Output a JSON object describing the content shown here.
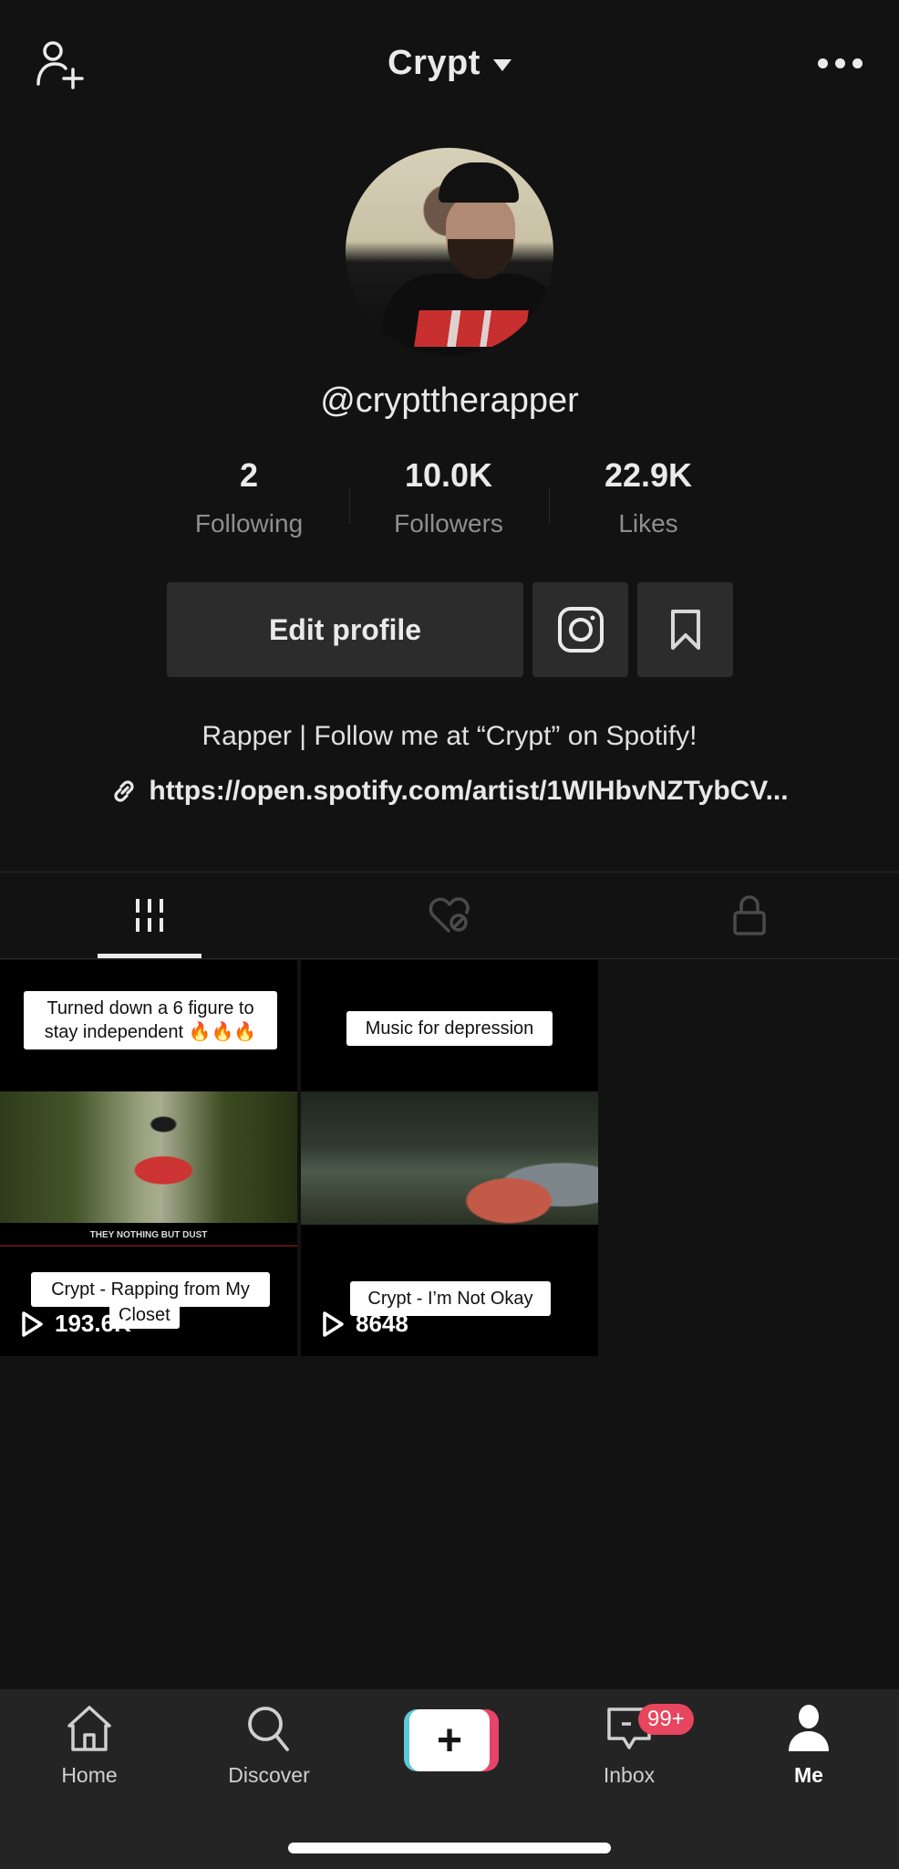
{
  "header": {
    "title": "Crypt",
    "add_user_icon": "person-plus-icon",
    "more_icon": "ellipsis-icon"
  },
  "profile": {
    "username": "@crypttherapper",
    "stats": [
      {
        "value": "2",
        "label": "Following"
      },
      {
        "value": "10.0K",
        "label": "Followers"
      },
      {
        "value": "22.9K",
        "label": "Likes"
      }
    ],
    "edit_profile_label": "Edit profile",
    "bio": "Rapper | Follow me at “Crypt” on Spotify!",
    "link": "https://open.spotify.com/artist/1WIHbvNZTybCV..."
  },
  "tabs": [
    {
      "name": "videos",
      "icon": "grid-icon",
      "active": true
    },
    {
      "name": "liked",
      "icon": "hidden-heart-icon",
      "active": false
    },
    {
      "name": "private",
      "icon": "lock-icon",
      "active": false
    }
  ],
  "videos": [
    {
      "top_caption_line1": "Turned down a 6 figure to",
      "top_caption_line2": "stay independent 🔥🔥🔥",
      "subtitle": "THEY NOTHING BUT DUST",
      "bottom_caption_line1": "Crypt - Rapping from My",
      "bottom_caption_line2": "Closet",
      "views": "193.6K"
    },
    {
      "top_caption_line1": "Music for depression",
      "bottom_caption_line1": "Crypt - I’m Not Okay",
      "views": "8648"
    }
  ],
  "bottom_nav": {
    "items": [
      {
        "label": "Home",
        "icon": "home-icon"
      },
      {
        "label": "Discover",
        "icon": "search-icon"
      },
      {
        "label": "",
        "icon": "create-plus-icon"
      },
      {
        "label": "Inbox",
        "icon": "inbox-icon"
      },
      {
        "label": "Me",
        "icon": "profile-icon"
      }
    ],
    "inbox_badge": "99+",
    "create_symbol": "+"
  },
  "colors": {
    "background": "#121212",
    "nav_background": "#242424",
    "button_background": "#2c2c2c",
    "badge": "#e8455e",
    "tiktok_cyan": "#5ec8d8",
    "tiktok_red": "#e8436a"
  }
}
